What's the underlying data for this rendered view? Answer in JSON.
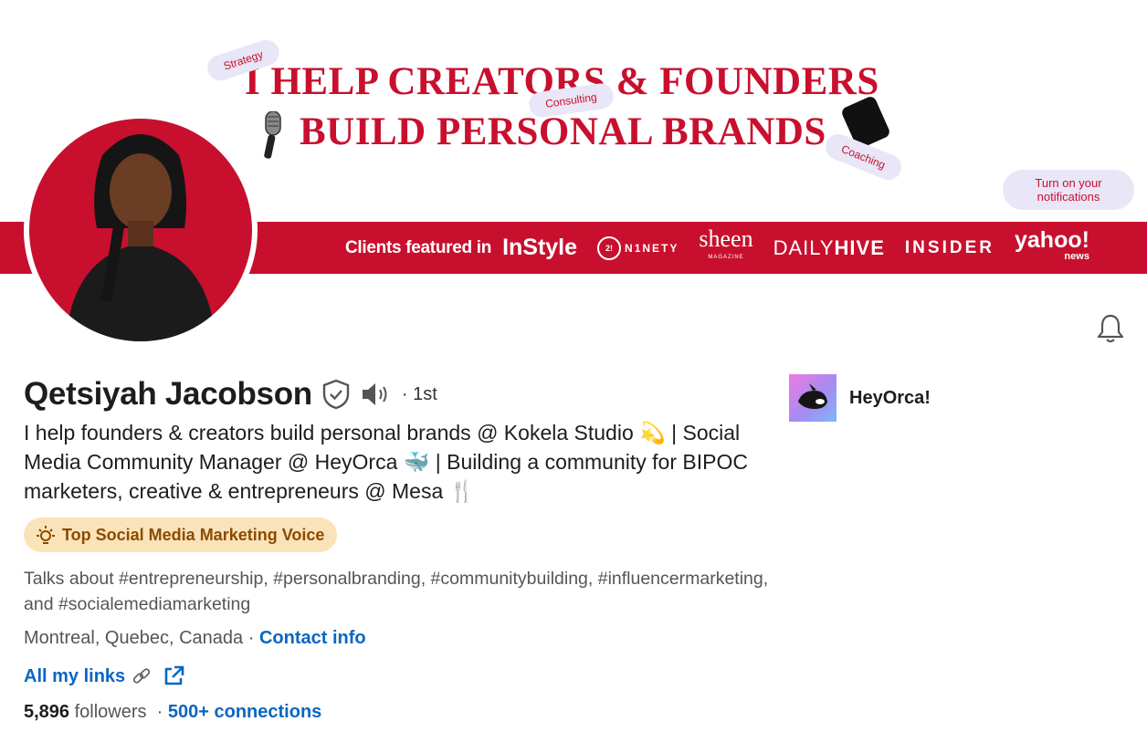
{
  "banner": {
    "headline_line1": "I HELP CREATORS & FOUNDERS",
    "headline_line2": "BUILD PERSONAL BRANDS",
    "pills": [
      "Strategy",
      "Consulting",
      "Coaching"
    ],
    "notifications_pill": "Turn on your notifications",
    "clients_label": "Clients featured in",
    "logos": {
      "instyle": "InStyle",
      "ninety_circle": "2!",
      "ninety": "N1NETY",
      "sheen": "sheen",
      "sheen_sub": "MAGAZINE",
      "daily": "DAILY",
      "hive": "HIVE",
      "insider": "INSIDER",
      "yahoo": "yahoo!",
      "yahoo_sub": "news"
    },
    "colors": {
      "brand_red": "#c8102e",
      "pill_bg": "#e8e6f7"
    }
  },
  "profile": {
    "name": "Qetsiyah Jacobson",
    "degree": "· 1st",
    "headline": "I help founders & creators build personal brands @ Kokela Studio 💫 | Social Media Community Manager @ HeyOrca 🐳 | Building a community for BIPOC marketers, creative & entrepreneurs @ Mesa 🍴",
    "voice_badge": "Top Social Media Marketing Voice",
    "talks_about": "Talks about #entrepreneurship, #personalbranding, #communitybuilding, #influencermarketing, and #socialemediamarketing",
    "location": "Montreal, Quebec, Canada",
    "location_sep": " · ",
    "contact_info": "Contact info",
    "all_links": "All my links",
    "followers_count": "5,896",
    "followers_label": " followers",
    "followers_sep": "  · ",
    "connections": "500+ connections"
  },
  "company": {
    "name": "HeyOrca!"
  },
  "icons": [
    "verified-shield-icon",
    "pronunciation-speaker-icon",
    "bell-icon",
    "lightbulb-icon",
    "link-chain-icon",
    "external-link-icon",
    "microphone-icon",
    "phone-icon"
  ],
  "colors": {
    "link_blue": "#0a66c2",
    "badge_bg": "#fbe3b9",
    "badge_text": "#8a4b00"
  }
}
